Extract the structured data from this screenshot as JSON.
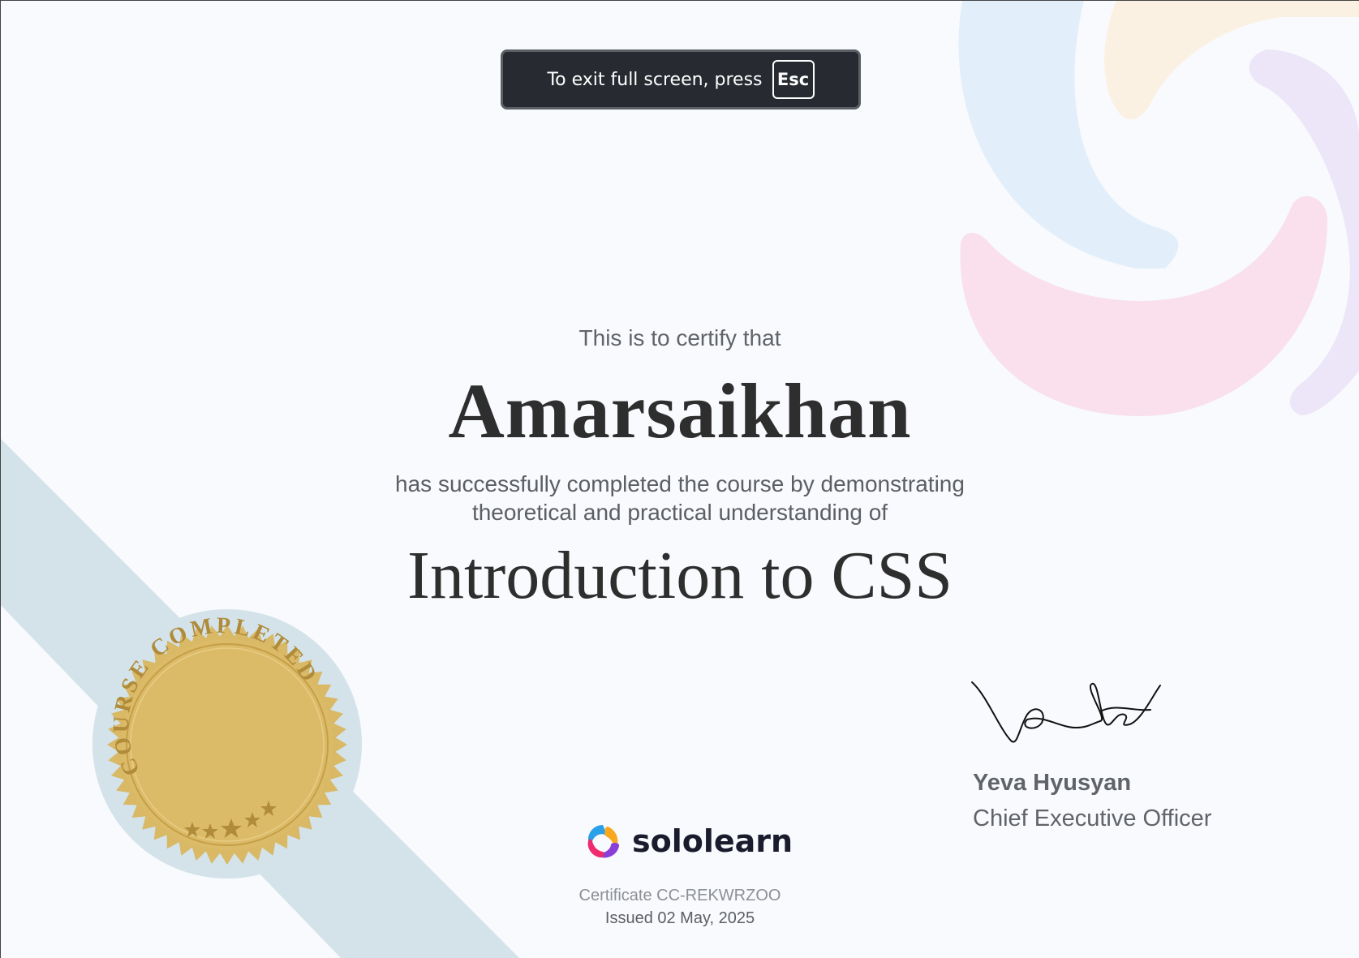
{
  "fullscreen_notice": {
    "text": "To exit full screen, press",
    "key": "Esc"
  },
  "certificate": {
    "intro": "This is to certify that",
    "recipient_name": "Amarsaikhan",
    "description_line1": "has successfully completed the course by demonstrating",
    "description_line2": "theoretical and practical understanding of",
    "course_title": "Introduction to CSS",
    "seal_text": "COURSE COMPLETED",
    "signer_name": "Yeva Hyusyan",
    "signer_title": "Chief Executive Officer",
    "certificate_id": "Certificate CC-REKWRZOO",
    "issued": "Issued 02 May, 2025"
  },
  "brand": {
    "name": "sololearn"
  },
  "colors": {
    "background": "#f8fafd",
    "toast_bg": "#272a30",
    "seal_gold": "#d9b866",
    "ribbon": "#d3e3e9",
    "deco_blue": "#e2effa",
    "deco_pink": "#f9e0ec",
    "deco_purple": "#ece6f8",
    "deco_orange": "#fbf1e3"
  }
}
